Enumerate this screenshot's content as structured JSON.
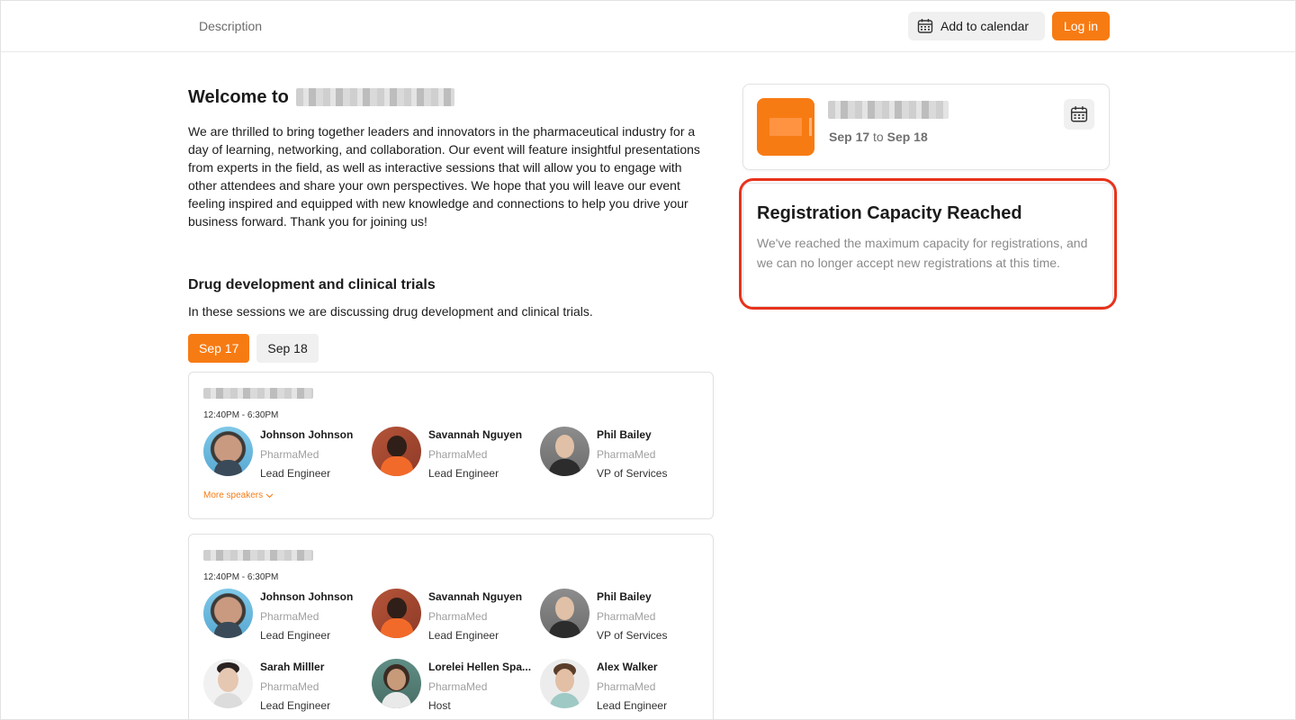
{
  "topbar": {
    "description_label": "Description",
    "add_to_calendar_label": "Add to calendar",
    "login_label": "Log in"
  },
  "main": {
    "welcome_prefix": "Welcome to",
    "intro": "We are thrilled to bring together leaders and innovators in the pharmaceutical industry for a day of learning, networking, and collaboration. Our event will feature insightful presentations from experts in the field, as well as interactive sessions that will allow you to engage with other attendees and share your own perspectives. We hope that you will leave our event feeling inspired and equipped with new knowledge and connections to help you drive your business forward. Thank you for joining us!",
    "track_title": "Drug development and clinical trials",
    "track_description": "In these sessions we are discussing drug development and clinical trials.",
    "day_tabs": [
      "Sep 17",
      "Sep 18"
    ],
    "sessions": [
      {
        "time": "12:40PM - 6:30PM",
        "more_label": "More speakers",
        "speakers": [
          {
            "name": "Johnson Johnson",
            "company": "PharmaMed",
            "role": "Lead Engineer"
          },
          {
            "name": "Savannah Nguyen",
            "company": "PharmaMed",
            "role": "Lead Engineer"
          },
          {
            "name": "Phil Bailey",
            "company": "PharmaMed",
            "role": "VP of Services"
          }
        ]
      },
      {
        "time": "12:40PM - 6:30PM",
        "speakers": [
          {
            "name": "Johnson Johnson",
            "company": "PharmaMed",
            "role": "Lead Engineer"
          },
          {
            "name": "Savannah Nguyen",
            "company": "PharmaMed",
            "role": "Lead Engineer"
          },
          {
            "name": "Phil Bailey",
            "company": "PharmaMed",
            "role": "VP of Services"
          },
          {
            "name": "Sarah Milller",
            "company": "PharmaMed",
            "role": "Lead Engineer"
          },
          {
            "name": "Lorelei Hellen Spa...",
            "company": "PharmaMed",
            "role": "Host"
          },
          {
            "name": "Alex Walker",
            "company": "PharmaMed",
            "role": "Lead Engineer"
          }
        ]
      }
    ]
  },
  "event_card": {
    "start_date": "Sep 17",
    "to_word": "to",
    "end_date": "Sep 18"
  },
  "capacity": {
    "title": "Registration Capacity Reached",
    "message": "We've reached the maximum capacity for registrations, and we can no longer accept new registrations at this time."
  },
  "colors": {
    "accent": "#f77b13",
    "highlight": "#e8321c"
  },
  "icons": {
    "calendar": "calendar-icon",
    "chevron": "chevron-down-icon"
  }
}
